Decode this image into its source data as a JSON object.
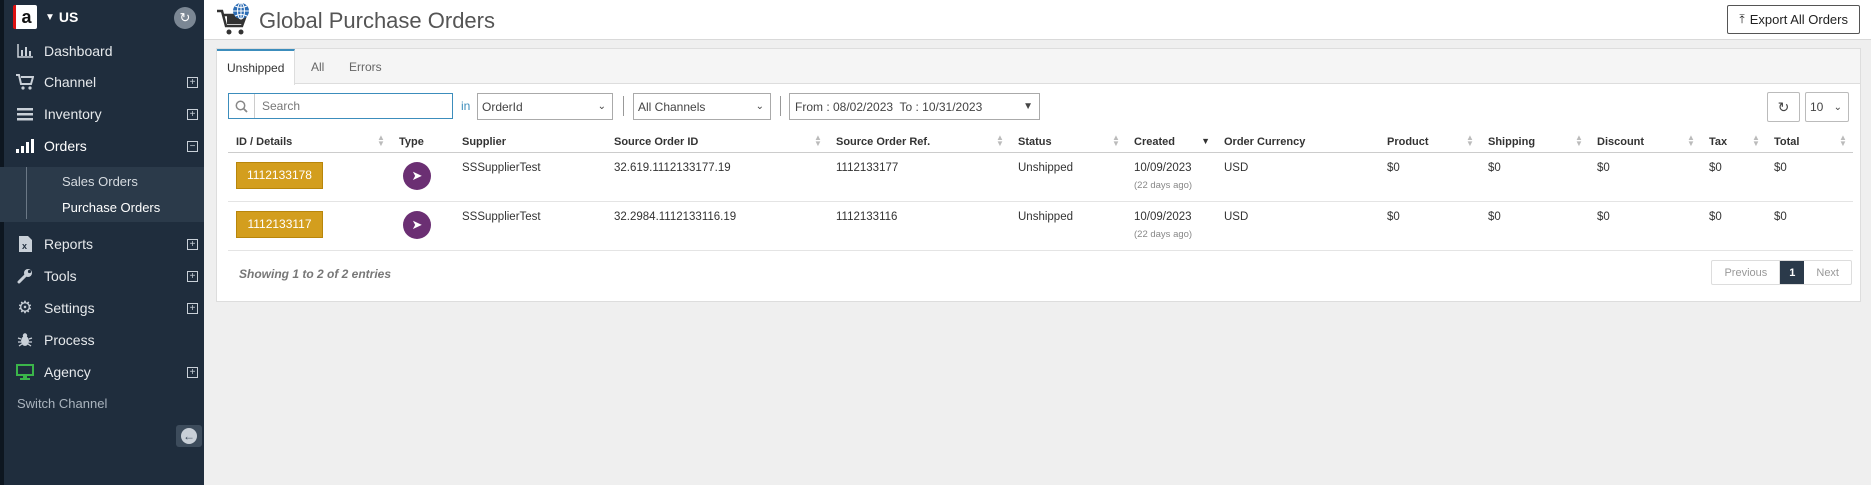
{
  "sidebar": {
    "region": "US",
    "nav": [
      {
        "label": "Dashboard",
        "icon": "bar-chart-icon",
        "expandable": false
      },
      {
        "label": "Channel",
        "icon": "cart-icon",
        "expandable": true
      },
      {
        "label": "Inventory",
        "icon": "list-icon",
        "expandable": true
      },
      {
        "label": "Orders",
        "icon": "signal-bars-icon",
        "expandable": true,
        "expanded": true
      },
      {
        "label": "Reports",
        "icon": "excel-icon",
        "expandable": true
      },
      {
        "label": "Tools",
        "icon": "wrench-icon",
        "expandable": true
      },
      {
        "label": "Settings",
        "icon": "gear-icon",
        "expandable": true
      },
      {
        "label": "Process",
        "icon": "bug-icon",
        "expandable": false
      },
      {
        "label": "Agency",
        "icon": "monitor-icon",
        "expandable": true
      }
    ],
    "orders_sub": [
      "Sales Orders",
      "Purchase Orders"
    ],
    "switch_channel": "Switch Channel",
    "plus": "+",
    "minus": "−"
  },
  "header": {
    "title": "Global Purchase Orders",
    "export_label": "Export All Orders"
  },
  "tabs": [
    "Unshipped",
    "All",
    "Errors"
  ],
  "filters": {
    "search_placeholder": "Search",
    "in_label": "in",
    "field": "OrderId",
    "channel": "All Channels",
    "date_range": "From : 08/02/2023  To : 10/31/2023",
    "page_size": "10"
  },
  "table": {
    "columns": [
      "ID / Details",
      "Type",
      "Supplier",
      "Source Order ID",
      "Source Order Ref.",
      "Status",
      "Created",
      "Order Currency",
      "Product",
      "Shipping",
      "Discount",
      "Tax",
      "Total"
    ],
    "rows": [
      {
        "id": "1112133178",
        "supplier": "SSSupplierTest",
        "source_order_id": "32.619.1112133177.19",
        "source_order_ref": "1112133177",
        "status": "Unshipped",
        "created": "10/09/2023",
        "created_ago": "(22 days ago)",
        "currency": "USD",
        "product": "$0",
        "shipping": "$0",
        "discount": "$0",
        "tax": "$0",
        "total": "$0"
      },
      {
        "id": "1112133117",
        "supplier": "SSSupplierTest",
        "source_order_id": "32.2984.1112133116.19",
        "source_order_ref": "1112133116",
        "status": "Unshipped",
        "created": "10/09/2023",
        "created_ago": "(22 days ago)",
        "currency": "USD",
        "product": "$0",
        "shipping": "$0",
        "discount": "$0",
        "tax": "$0",
        "total": "$0"
      }
    ]
  },
  "footer": {
    "showing": "Showing 1 to 2 of 2 entries",
    "previous": "Previous",
    "current_page": "1",
    "next": "Next"
  },
  "colors": {
    "sidebar_bg": "#1f2d3d",
    "id_button": "#d39e1e",
    "type_icon": "#6b2f73",
    "accent": "#3c8dbc"
  }
}
